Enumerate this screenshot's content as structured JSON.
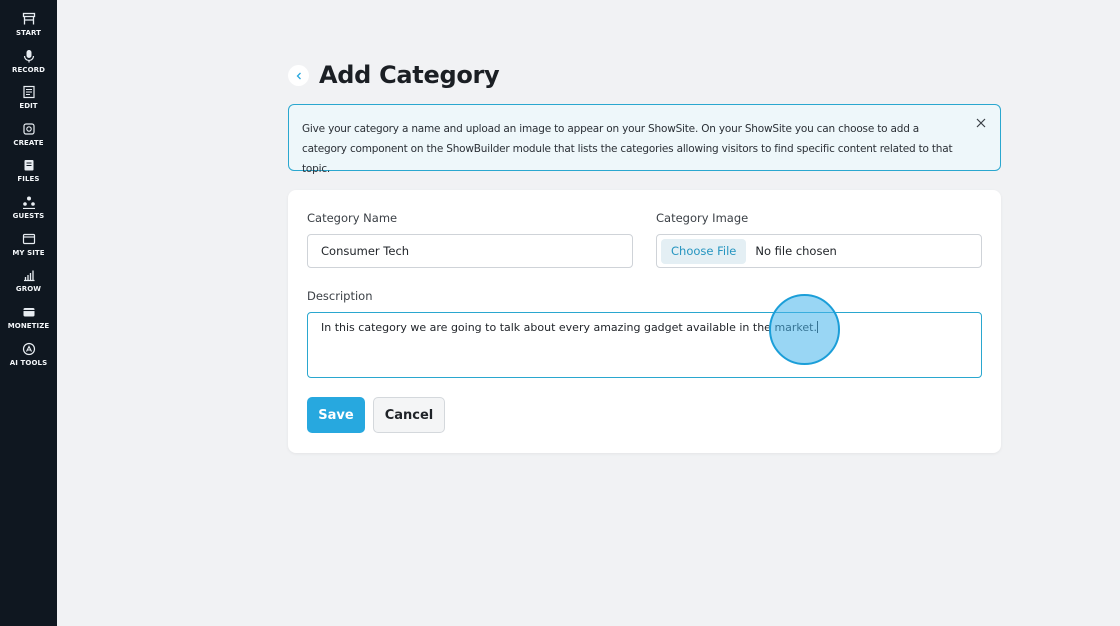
{
  "sidebar": {
    "items": [
      {
        "label": "START",
        "icon": "start-icon"
      },
      {
        "label": "RECORD",
        "icon": "microphone-icon"
      },
      {
        "label": "EDIT",
        "icon": "edit-icon"
      },
      {
        "label": "CREATE",
        "icon": "create-icon"
      },
      {
        "label": "FILES",
        "icon": "files-icon"
      },
      {
        "label": "GUESTS",
        "icon": "guests-icon"
      },
      {
        "label": "MY SITE",
        "icon": "site-icon"
      },
      {
        "label": "GROW",
        "icon": "chart-icon"
      },
      {
        "label": "MONETIZE",
        "icon": "monetize-icon"
      },
      {
        "label": "AI TOOLS",
        "icon": "ai-tools-icon"
      }
    ]
  },
  "header": {
    "title": "Add Category"
  },
  "info": {
    "text": "Give your category a name and upload an image to appear on your ShowSite. On your ShowSite you can choose to add a category component on the ShowBuilder module that lists the categories allowing visitors to find specific content related to that topic."
  },
  "form": {
    "name_label": "Category Name",
    "name_value": "Consumer Tech",
    "image_label": "Category Image",
    "choose_file_label": "Choose File",
    "no_file_text": "No file chosen",
    "description_label": "Description",
    "description_value": "In this category we are going to talk about every amazing gadget available in the market."
  },
  "actions": {
    "save_label": "Save",
    "cancel_label": "Cancel"
  },
  "colors": {
    "sidebar_bg": "#0f1720",
    "accent": "#27a8df",
    "info_border": "#2aa7cf",
    "info_bg": "#eef7fa"
  }
}
